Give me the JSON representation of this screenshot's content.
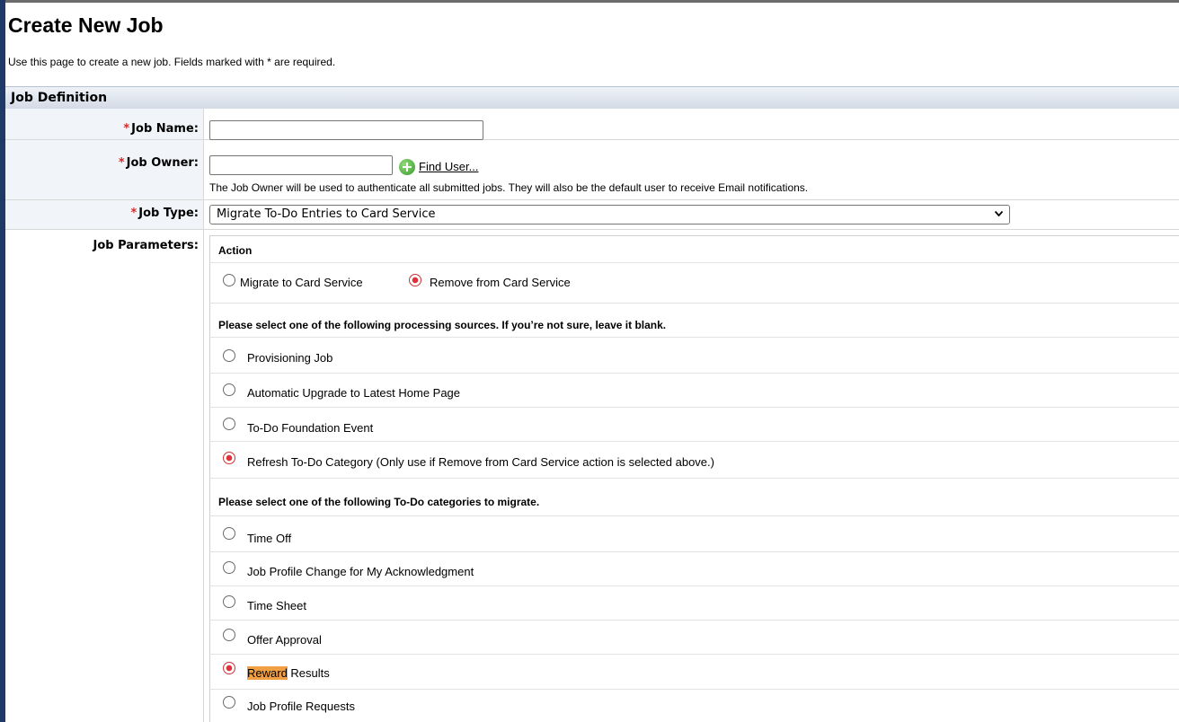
{
  "page": {
    "title": "Create New Job",
    "instructions": "Use this page to create a new job. Fields marked with * are required."
  },
  "section": {
    "title": "Job Definition"
  },
  "fields": {
    "required_marker": "*",
    "job_name": {
      "label": "Job Name:",
      "value": ""
    },
    "job_owner": {
      "label": "Job Owner:",
      "value": "",
      "find_user_label": "Find User...",
      "help": "The Job Owner will be used to authenticate all submitted jobs. They will also be the default user to receive Email notifications."
    },
    "job_type": {
      "label": "Job Type:",
      "selected": "Migrate To-Do Entries to Card Service"
    },
    "job_parameters": {
      "label": "Job Parameters:"
    }
  },
  "params": {
    "action": {
      "heading": "Action",
      "options": [
        {
          "label": "Migrate to Card Service",
          "selected": false
        },
        {
          "label": "Remove from Card Service",
          "selected": true
        }
      ]
    },
    "sources": {
      "heading": "Please select one of the following processing sources. If you’re not sure, leave it blank.",
      "options": [
        {
          "label": "Provisioning Job",
          "selected": false
        },
        {
          "label": "Automatic Upgrade to Latest Home Page",
          "selected": false
        },
        {
          "label": "To-Do Foundation Event",
          "selected": false
        },
        {
          "label": "Refresh To-Do Category (Only use if Remove from Card Service action is selected above.)",
          "selected": true
        }
      ]
    },
    "categories": {
      "heading": "Please select one of the following To-Do categories to migrate.",
      "options": [
        {
          "label": "Time Off",
          "selected": false
        },
        {
          "label": "Job Profile Change for My Acknowledgment",
          "selected": false
        },
        {
          "label": "Time Sheet",
          "selected": false
        },
        {
          "label": "Offer Approval",
          "selected": false
        },
        {
          "label": "Reward",
          "label_rest": " Results",
          "highlight": "Reward",
          "selected": true
        },
        {
          "label": "Job Profile Requests",
          "selected": false
        }
      ]
    }
  },
  "colors": {
    "accent_bar": "#1f3a66",
    "required": "#d42a2a",
    "radio_selected": "#e0303a",
    "highlight": "#f0a042"
  }
}
